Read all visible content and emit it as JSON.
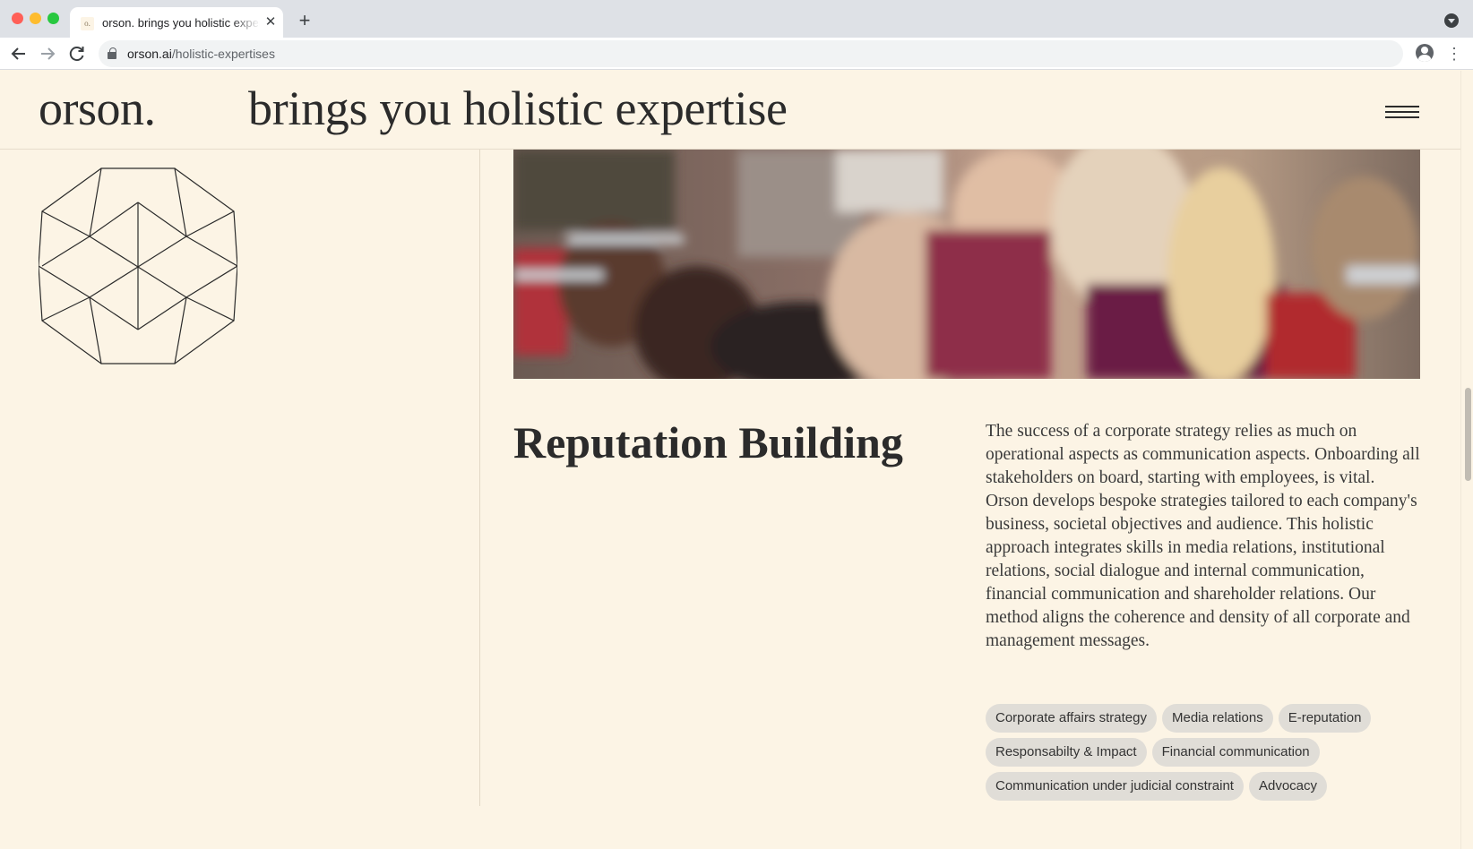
{
  "browser": {
    "tab_title": "orson. brings you holistic expertise",
    "favicon_text": "o.",
    "url_domain": "orson.ai",
    "url_path": "/holistic-expertises"
  },
  "header": {
    "logo": "orson.",
    "tagline": "brings you holistic expertise"
  },
  "section": {
    "title": "Reputation Building",
    "paragraphs": [
      "The success of a corporate strategy relies as much on operational aspects as communication aspects. Onboarding all stakeholders on board, starting with employees, is vital.",
      "Orson develops bespoke strategies tailored to each company's business, societal objectives and audience. This holistic approach integrates skills in media relations, institutional relations, social dialogue and internal communication, financial communication and shareholder relations. Our method aligns the coherence and density of all corporate and management messages."
    ],
    "tags": [
      "Corporate affairs strategy",
      "Media relations",
      "E-reputation",
      "Responsabilty & Impact",
      "Financial communication",
      "Communication under judicial constraint",
      "Advocacy"
    ]
  },
  "icons": {
    "back": "arrow-left-icon",
    "forward": "arrow-right-icon",
    "reload": "reload-icon",
    "lock": "lock-icon",
    "bookmark": "star-icon",
    "profile": "profile-icon",
    "menu": "kebab-menu-icon",
    "site_menu": "hamburger-menu-icon",
    "solid": "dodecahedron-icon"
  },
  "colors": {
    "page_background": "#fcf4e5",
    "text": "#2b2b2b",
    "tag_background": "#e0ddd7"
  }
}
